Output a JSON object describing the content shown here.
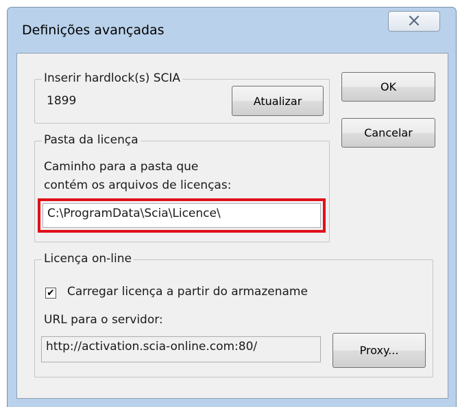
{
  "window": {
    "title": "Definições avançadas"
  },
  "hardlock": {
    "legend": "Inserir hardlock(s) SCIA",
    "value": "1899",
    "update_label": "Atualizar"
  },
  "buttons": {
    "ok_label": "OK",
    "cancel_label": "Cancelar"
  },
  "license_folder": {
    "legend": "Pasta da licença",
    "description_line1": "Caminho para a pasta que",
    "description_line2": "contém os arquivos de licenças:",
    "path_value": "C:\\ProgramData\\Scia\\Licence\\"
  },
  "online_license": {
    "legend": "Licença on-line",
    "checkbox_label": "Carregar licença a partir do armazename",
    "checkbox_checked": true,
    "url_label": "URL para o servidor:",
    "url_value": "http://activation.scia-online.com:80/",
    "proxy_label": "Proxy..."
  },
  "colors": {
    "highlight": "#e0101a",
    "titlebar": "#b9d1ea",
    "dialog_bg": "#f0f0f0"
  },
  "icons": {
    "close": "close-icon",
    "check": "check-icon"
  }
}
